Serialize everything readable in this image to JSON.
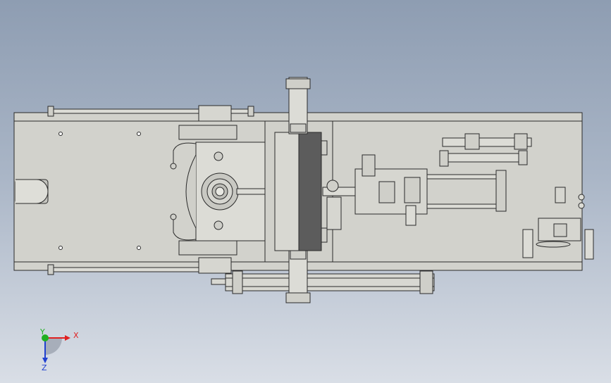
{
  "triad": {
    "x_label": "X",
    "y_label": "Y",
    "z_label": "Z",
    "x_color": "#e02020",
    "y_color": "#20b020",
    "z_color": "#2040d0"
  },
  "palette": {
    "plate": "#d2d2cc",
    "part": "#dcdcd6",
    "dark_block": "#5c5c5c",
    "edge": "#2a2a2a"
  }
}
